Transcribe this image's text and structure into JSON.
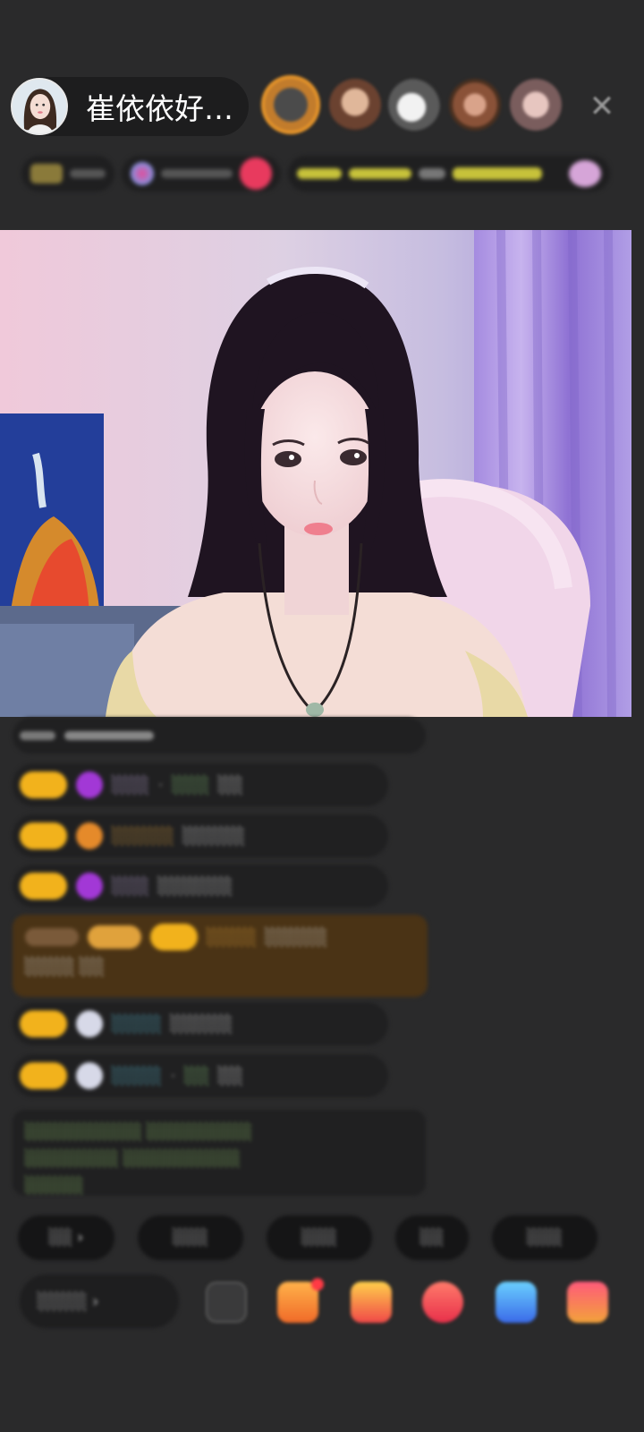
{
  "header": {
    "host_name": "崔依依好…",
    "viewers": [
      "viewer-avatar-1",
      "viewer-avatar-2",
      "viewer-avatar-3",
      "viewer-avatar-4",
      "viewer-avatar-5"
    ],
    "close_icon": "✕"
  },
  "badges": {
    "items": [
      "···",
      "···",
      "···",
      "···"
    ]
  },
  "stream": {
    "description_visible": false
  },
  "chat": {
    "messages": [
      {
        "level": "",
        "user": "",
        "text": ""
      },
      {
        "level": "",
        "user": "",
        "text": ""
      },
      {
        "level": "",
        "user": "",
        "text": ""
      },
      {
        "level": "",
        "user": "",
        "text": ""
      },
      {
        "level": "",
        "user": "",
        "text": ""
      },
      {
        "level": "",
        "user": "",
        "text": ""
      },
      {
        "level": "",
        "user": "",
        "text": ""
      },
      {
        "level": "",
        "user": "",
        "text": ""
      }
    ]
  },
  "quick_phrases": [
    "",
    "",
    "",
    "",
    ""
  ],
  "bottom": {
    "say_placeholder": ""
  },
  "colors": {
    "background": "#2a2a2b",
    "level_badge": "#f2b21c",
    "system_text": "#97d36e",
    "gold_bubble": "#4a3315"
  }
}
